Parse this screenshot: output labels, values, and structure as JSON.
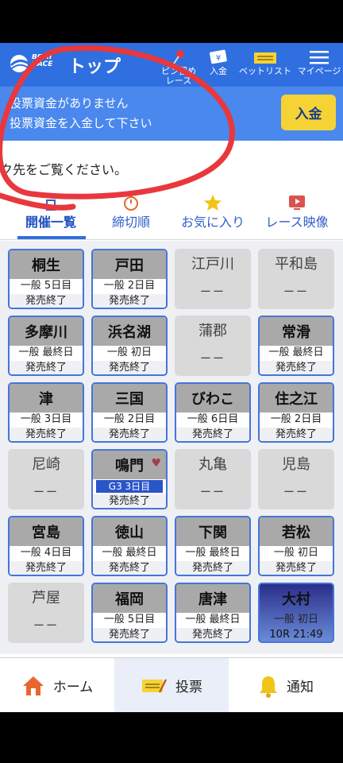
{
  "header": {
    "logo_text": "BOAT RACE",
    "title": "トップ",
    "nav": [
      {
        "label": "ピン留め\nレース",
        "icon": "pin-icon"
      },
      {
        "label": "入金",
        "icon": "yen-card-icon"
      },
      {
        "label": "ベットリスト",
        "icon": "ticket-icon"
      },
      {
        "label": "マイページ",
        "icon": "hamburger-menu-icon"
      }
    ]
  },
  "notice": {
    "line1": "投票資金がありません",
    "line2": "投票資金を入金して下さい",
    "button": "入金"
  },
  "info_line": "ク先をご覧ください。",
  "tabs": [
    {
      "label": "開催一覧",
      "icon": "list-icon",
      "active": true
    },
    {
      "label": "締切順",
      "icon": "stopwatch-icon",
      "active": false
    },
    {
      "label": "お気に入り",
      "icon": "star-icon",
      "active": false
    },
    {
      "label": "レース映像",
      "icon": "video-icon",
      "active": false
    }
  ],
  "venues": [
    {
      "name": "桐生",
      "grade": "一般 5日目",
      "status": "発売終了",
      "open": true
    },
    {
      "name": "戸田",
      "grade": "一般 2日目",
      "status": "発売終了",
      "open": true
    },
    {
      "name": "江戸川",
      "dash": "ーー",
      "open": false
    },
    {
      "name": "平和島",
      "dash": "ーー",
      "open": false
    },
    {
      "name": "多摩川",
      "grade": "一般 最終日",
      "status": "発売終了",
      "open": true
    },
    {
      "name": "浜名湖",
      "grade": "一般 初日",
      "status": "発売終了",
      "open": true
    },
    {
      "name": "蒲郡",
      "dash": "ーー",
      "open": false
    },
    {
      "name": "常滑",
      "grade": "一般 最終日",
      "status": "発売終了",
      "open": true
    },
    {
      "name": "津",
      "grade": "一般 3日目",
      "status": "発売終了",
      "open": true
    },
    {
      "name": "三国",
      "grade": "一般 2日目",
      "status": "発売終了",
      "open": true
    },
    {
      "name": "びわこ",
      "grade": "一般 6日目",
      "status": "発売終了",
      "open": true
    },
    {
      "name": "住之江",
      "grade": "一般 2日目",
      "status": "発売終了",
      "open": true
    },
    {
      "name": "尼崎",
      "dash": "ーー",
      "open": false
    },
    {
      "name": "鳴門",
      "grade": "G3  3日目",
      "status": "発売終了",
      "open": true,
      "favorite": true
    },
    {
      "name": "丸亀",
      "dash": "ーー",
      "open": false
    },
    {
      "name": "児島",
      "dash": "ーー",
      "open": false
    },
    {
      "name": "宮島",
      "grade": "一般 4日目",
      "status": "発売終了",
      "open": true
    },
    {
      "name": "徳山",
      "grade": "一般 最終日",
      "status": "発売終了",
      "open": true
    },
    {
      "name": "下関",
      "grade": "一般 最終日",
      "status": "発売終了",
      "open": true
    },
    {
      "name": "若松",
      "grade": "一般 初日",
      "status": "発売終了",
      "open": true
    },
    {
      "name": "芦屋",
      "dash": "ーー",
      "open": false
    },
    {
      "name": "福岡",
      "grade": "一般 5日目",
      "status": "発売終了",
      "open": true
    },
    {
      "name": "唐津",
      "grade": "一般 最終日",
      "status": "発売終了",
      "open": true
    },
    {
      "name": "大村",
      "grade": "一般 初日",
      "status": "10R 21:49",
      "open": true,
      "night": true
    }
  ],
  "bottom_nav": [
    {
      "label": "ホーム",
      "icon": "home-icon"
    },
    {
      "label": "投票",
      "icon": "bet-card-icon",
      "active": true
    },
    {
      "label": "通知",
      "icon": "bell-icon"
    }
  ],
  "colors": {
    "header": "#2f6fe0",
    "notice": "#4a88ee",
    "deposit_button": "#f6d335",
    "annotation": "#e8383d"
  }
}
